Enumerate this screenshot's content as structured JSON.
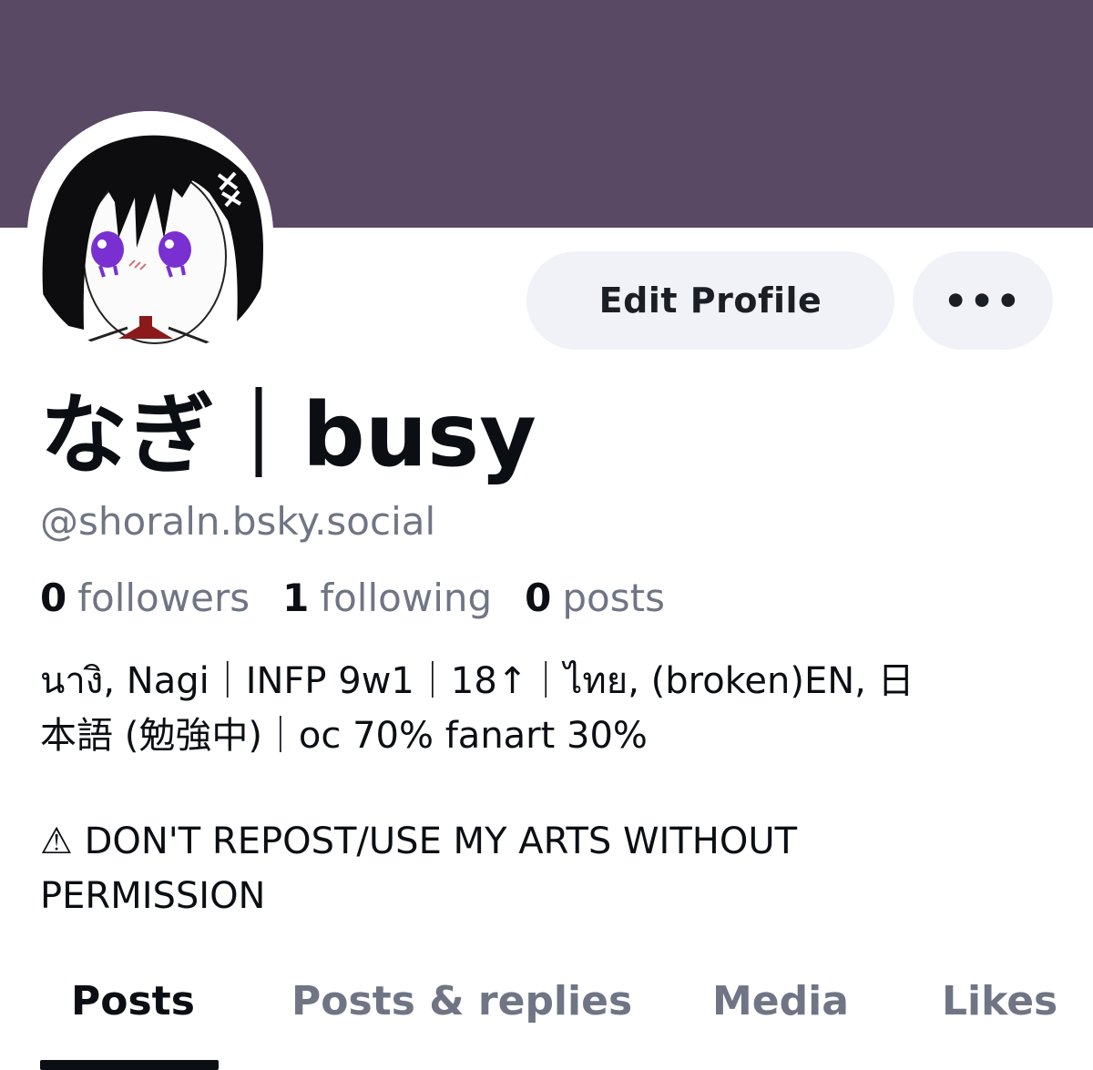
{
  "profile": {
    "display_name": "なぎ｜busy",
    "handle": "@shoraln.bsky.social",
    "banner_color": "#5a4964"
  },
  "actions": {
    "edit_label": "Edit Profile",
    "more_label": "•••"
  },
  "stats": [
    {
      "count": "0",
      "label": "followers"
    },
    {
      "count": "1",
      "label": "following"
    },
    {
      "count": "0",
      "label": "posts"
    }
  ],
  "bio": {
    "line1": "นางิ, Nagi｜INFP 9w1｜18↑｜ไทย, (broken)EN, 日",
    "line2": "本語 (勉強中)｜oc 70% fanart 30%",
    "line3": "⚠ DON'T REPOST/USE MY ARTS WITHOUT",
    "line4": "PERMISSION"
  },
  "tabs": [
    {
      "label": "Posts",
      "active": true
    },
    {
      "label": "Posts & replies",
      "active": false
    },
    {
      "label": "Media",
      "active": false
    },
    {
      "label": "Likes",
      "active": false
    }
  ]
}
